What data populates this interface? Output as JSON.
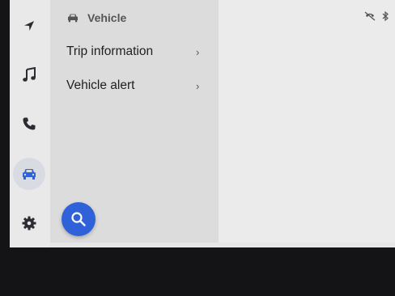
{
  "colors": {
    "accent": "#2f62d8",
    "rail_icon": "#2b2b33",
    "active_icon": "#2f62d8"
  },
  "nav_rail": {
    "items": [
      {
        "name": "navigation",
        "icon": "navigation-arrow-icon",
        "active": false
      },
      {
        "name": "media",
        "icon": "music-note-icon",
        "active": false
      },
      {
        "name": "phone",
        "icon": "phone-icon",
        "active": false
      },
      {
        "name": "vehicle",
        "icon": "car-icon",
        "active": true
      },
      {
        "name": "settings",
        "icon": "gear-icon",
        "active": false
      }
    ]
  },
  "panel": {
    "header_icon": "car-icon",
    "title": "Vehicle",
    "items": [
      {
        "label": "Trip information",
        "chevron": "›"
      },
      {
        "label": "Vehicle alert",
        "chevron": "›"
      }
    ]
  },
  "search_fab": {
    "icon": "search-icon"
  },
  "status_bar": {
    "icons": [
      "no-phone-icon",
      "bluetooth-icon"
    ]
  }
}
